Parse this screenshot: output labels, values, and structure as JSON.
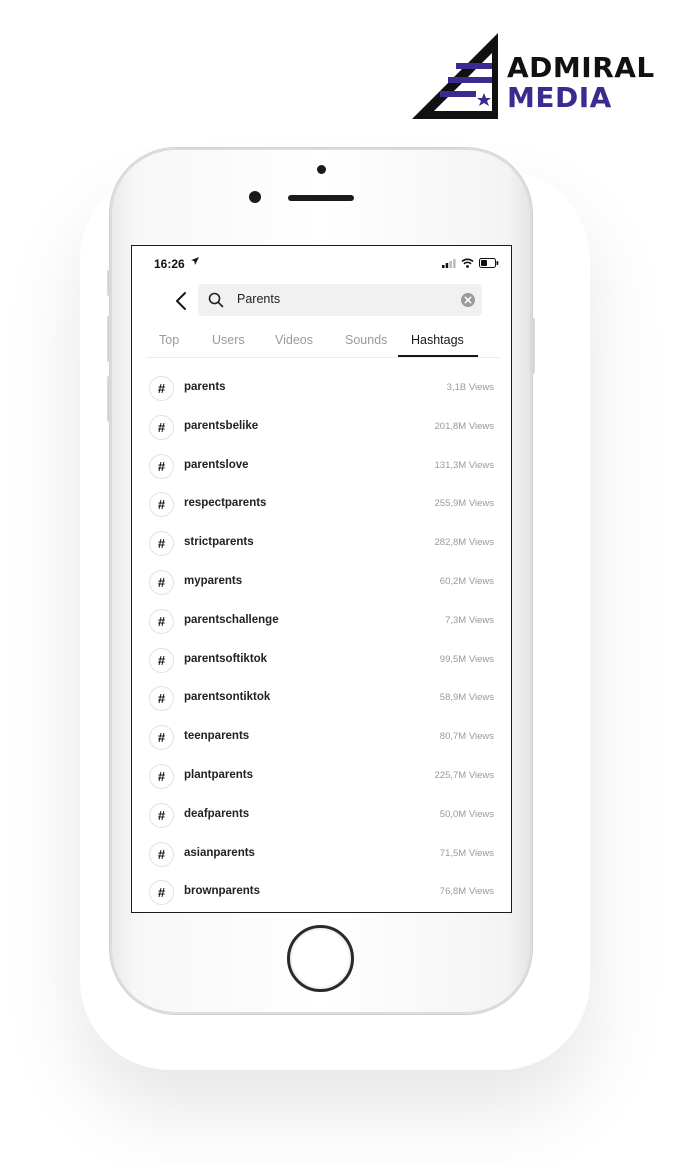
{
  "brand": {
    "line1": "ADMIRAL",
    "line2": "MEDIA",
    "color_dark": "#111111",
    "color_accent": "#3b2a8f"
  },
  "status_bar": {
    "time": "16:26",
    "icons": [
      "location-arrow-icon",
      "signal-icon",
      "wifi-icon",
      "battery-icon"
    ]
  },
  "search": {
    "value": "Parents",
    "back_icon": "chevron-left-icon",
    "search_icon": "search-icon",
    "clear_icon": "clear-icon"
  },
  "tabs": [
    {
      "label": "Top",
      "active": false
    },
    {
      "label": "Users",
      "active": false
    },
    {
      "label": "Videos",
      "active": false
    },
    {
      "label": "Sounds",
      "active": false
    },
    {
      "label": "Hashtags",
      "active": true
    }
  ],
  "hashtags": [
    {
      "icon": "#",
      "name": "parents",
      "views": "3,1B Views"
    },
    {
      "icon": "#",
      "name": "parentsbelike",
      "views": "201,8M Views"
    },
    {
      "icon": "#",
      "name": "parentslove",
      "views": "131,3M Views"
    },
    {
      "icon": "#",
      "name": "respectparents",
      "views": "255,9M Views"
    },
    {
      "icon": "#",
      "name": "strictparents",
      "views": "282,8M Views"
    },
    {
      "icon": "#",
      "name": "myparents",
      "views": "60,2M Views"
    },
    {
      "icon": "#",
      "name": "parentschallenge",
      "views": "7,3M Views"
    },
    {
      "icon": "#",
      "name": "parentsoftiktok",
      "views": "99,5M Views"
    },
    {
      "icon": "#",
      "name": "parentsontiktok",
      "views": "58,9M Views"
    },
    {
      "icon": "#",
      "name": "teenparents",
      "views": "80,7M Views"
    },
    {
      "icon": "#",
      "name": "plantparents",
      "views": "225,7M Views"
    },
    {
      "icon": "#",
      "name": "deafparents",
      "views": "50,0M Views"
    },
    {
      "icon": "#",
      "name": "asianparents",
      "views": "71,5M Views"
    },
    {
      "icon": "#",
      "name": "brownparents",
      "views": "76,8M Views"
    }
  ]
}
